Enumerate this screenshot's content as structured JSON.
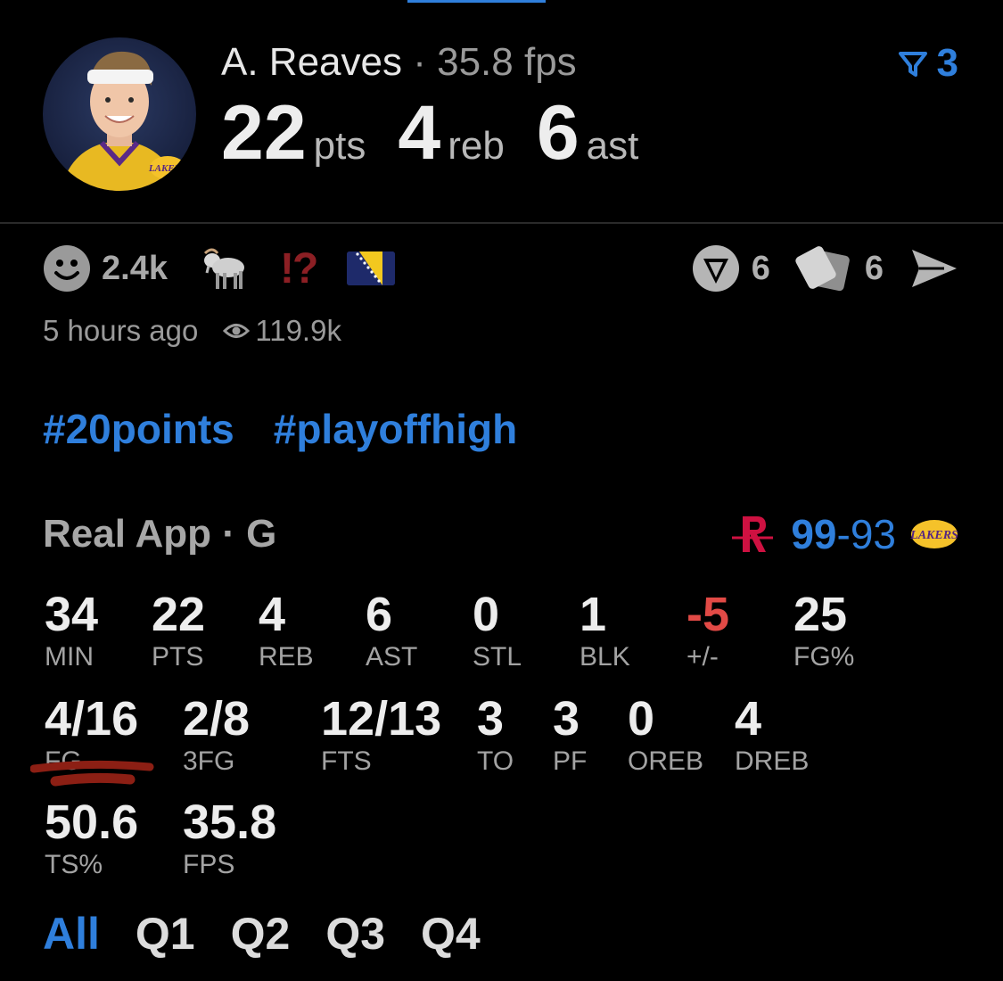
{
  "header": {
    "player_name": "A. Reaves",
    "separator": "·",
    "fps_text": "35.8 fps",
    "filter_count": "3",
    "headline": {
      "points": "22",
      "points_unit": "pts",
      "rebounds": "4",
      "rebounds_unit": "reb",
      "assists": "6",
      "assists_unit": "ast"
    }
  },
  "reactions": {
    "smiley_count": "2.4k",
    "exclaim": "!?",
    "timestamp": "5 hours ago",
    "views": "119.9k"
  },
  "actions": {
    "comments_count": "6",
    "cards_count": "6"
  },
  "tags": [
    "#20points",
    "#playoffhigh"
  ],
  "source": {
    "label": "Real App · G"
  },
  "score": {
    "home": "99",
    "dash": "-",
    "away": "93"
  },
  "stats": {
    "row1": [
      {
        "value": "34",
        "label": "MIN"
      },
      {
        "value": "22",
        "label": "PTS"
      },
      {
        "value": "4",
        "label": "REB"
      },
      {
        "value": "6",
        "label": "AST"
      },
      {
        "value": "0",
        "label": "STL"
      },
      {
        "value": "1",
        "label": "BLK"
      },
      {
        "value": "-5",
        "label": "+/-"
      },
      {
        "value": "25",
        "label": "FG%"
      }
    ],
    "row2": [
      {
        "value": "4/16",
        "label": "FG"
      },
      {
        "value": "2/8",
        "label": "3FG"
      },
      {
        "value": "12/13",
        "label": "FTS"
      },
      {
        "value": "3",
        "label": "TO"
      },
      {
        "value": "3",
        "label": "PF"
      },
      {
        "value": "0",
        "label": "OREB"
      },
      {
        "value": "4",
        "label": "DREB"
      }
    ],
    "row3": [
      {
        "value": "50.6",
        "label": "TS%"
      },
      {
        "value": "35.8",
        "label": "FPS"
      }
    ]
  },
  "quarters": [
    "All",
    "Q1",
    "Q2",
    "Q3",
    "Q4"
  ],
  "active_quarter": "All",
  "colors": {
    "accent": "#2f7fdc",
    "negative": "#e24a46",
    "markup_red": "#8c1f14"
  },
  "icons": [
    "avatar",
    "filter-icon",
    "smiley-icon",
    "goat-icon",
    "flag-icon",
    "comment-icon",
    "cards-icon",
    "share-icon",
    "eye-icon",
    "rockets-logo",
    "lakers-logo"
  ]
}
